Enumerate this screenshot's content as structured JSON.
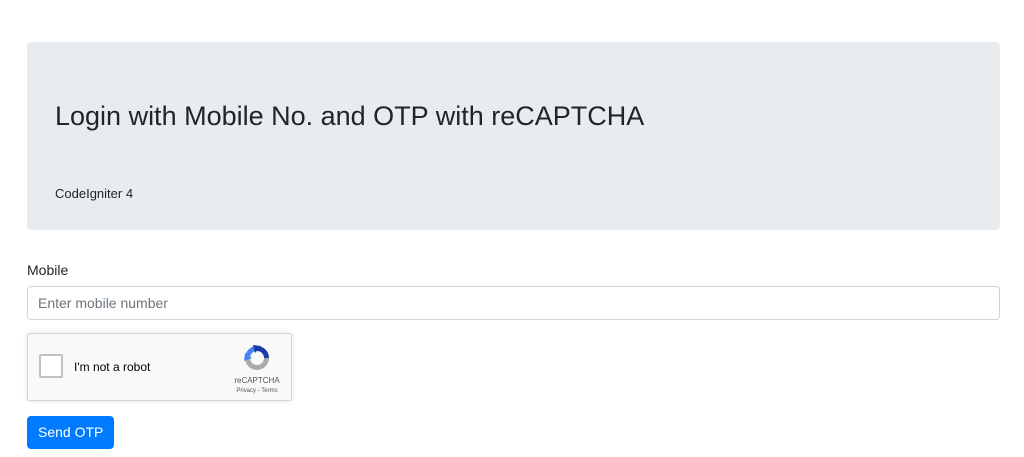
{
  "header": {
    "title": "Login with Mobile No. and OTP with reCAPTCHA",
    "subtitle": "CodeIgniter 4"
  },
  "form": {
    "mobile_label": "Mobile",
    "mobile_placeholder": "Enter mobile number",
    "mobile_value": "",
    "submit_label": "Send OTP"
  },
  "recaptcha": {
    "checkbox_label": "I'm not a robot",
    "brand": "reCAPTCHA",
    "privacy_link": "Privacy",
    "separator": " - ",
    "terms_link": "Terms",
    "checked": false,
    "icon": "recaptcha-logo-icon"
  },
  "colors": {
    "primary": "#007bff",
    "jumbotron_bg": "#e9ecef",
    "recaptcha_blue": "#1c3aa9",
    "recaptcha_light_blue": "#4285f4",
    "recaptcha_gray": "#ababab"
  }
}
